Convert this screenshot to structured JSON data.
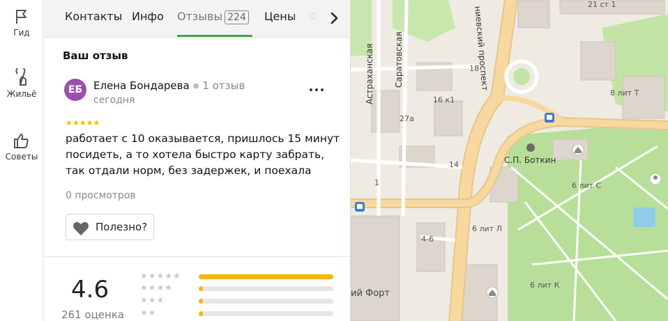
{
  "rail": {
    "items": [
      {
        "label": "Гид",
        "icon": "flag-icon"
      },
      {
        "label": "Жильё",
        "icon": "building-icon"
      },
      {
        "label": "Советы",
        "icon": "thumb-up-icon"
      }
    ]
  },
  "tabs": [
    {
      "label": "Контакты"
    },
    {
      "label": "Инфо"
    },
    {
      "label": "Отзывы",
      "count": "224",
      "active": true
    },
    {
      "label": "Цены"
    },
    {
      "label": "Ф"
    }
  ],
  "section_title": "Ваш отзыв",
  "review": {
    "avatar_initials": "ЕБ",
    "avatar_color": "#9b4fae",
    "author": "Елена Бондарева",
    "author_reviews": "1 отзыв",
    "date": "сегодня",
    "stars": "★★★★★",
    "star_color": "#f7b500",
    "text": "работает с 10 оказывается, пришлось 15 минут посидеть, а то хотела быстро карту забрать, так отдали норм, без задержек, и поехала",
    "views": "0 просмотров",
    "useful_label": "Полезно?"
  },
  "summary": {
    "rating": "4.6",
    "count": "261 оценка",
    "distribution": [
      {
        "stars": "★★★★★",
        "fraction": 1.0
      },
      {
        "stars": "★★★★",
        "fraction": 0.03
      },
      {
        "stars": "★★★",
        "fraction": 0.02
      },
      {
        "stars": "★★",
        "fraction": 0.015
      }
    ]
  },
  "map": {
    "labels": {
      "a": "21 ст 1",
      "b": "18",
      "c": "16 к1",
      "d": "27а",
      "e": "8 лит Т",
      "f": "14",
      "g": "С.П. Боткин",
      "h": "6 лит С",
      "i": "6 лит Л",
      "j": "4-6",
      "k": "1",
      "l": "6 лит К",
      "m": "ий Форт"
    },
    "streets": {
      "astr": "Астраханская",
      "sar": "Саратовская",
      "prosp": "ниевский проспект"
    }
  }
}
